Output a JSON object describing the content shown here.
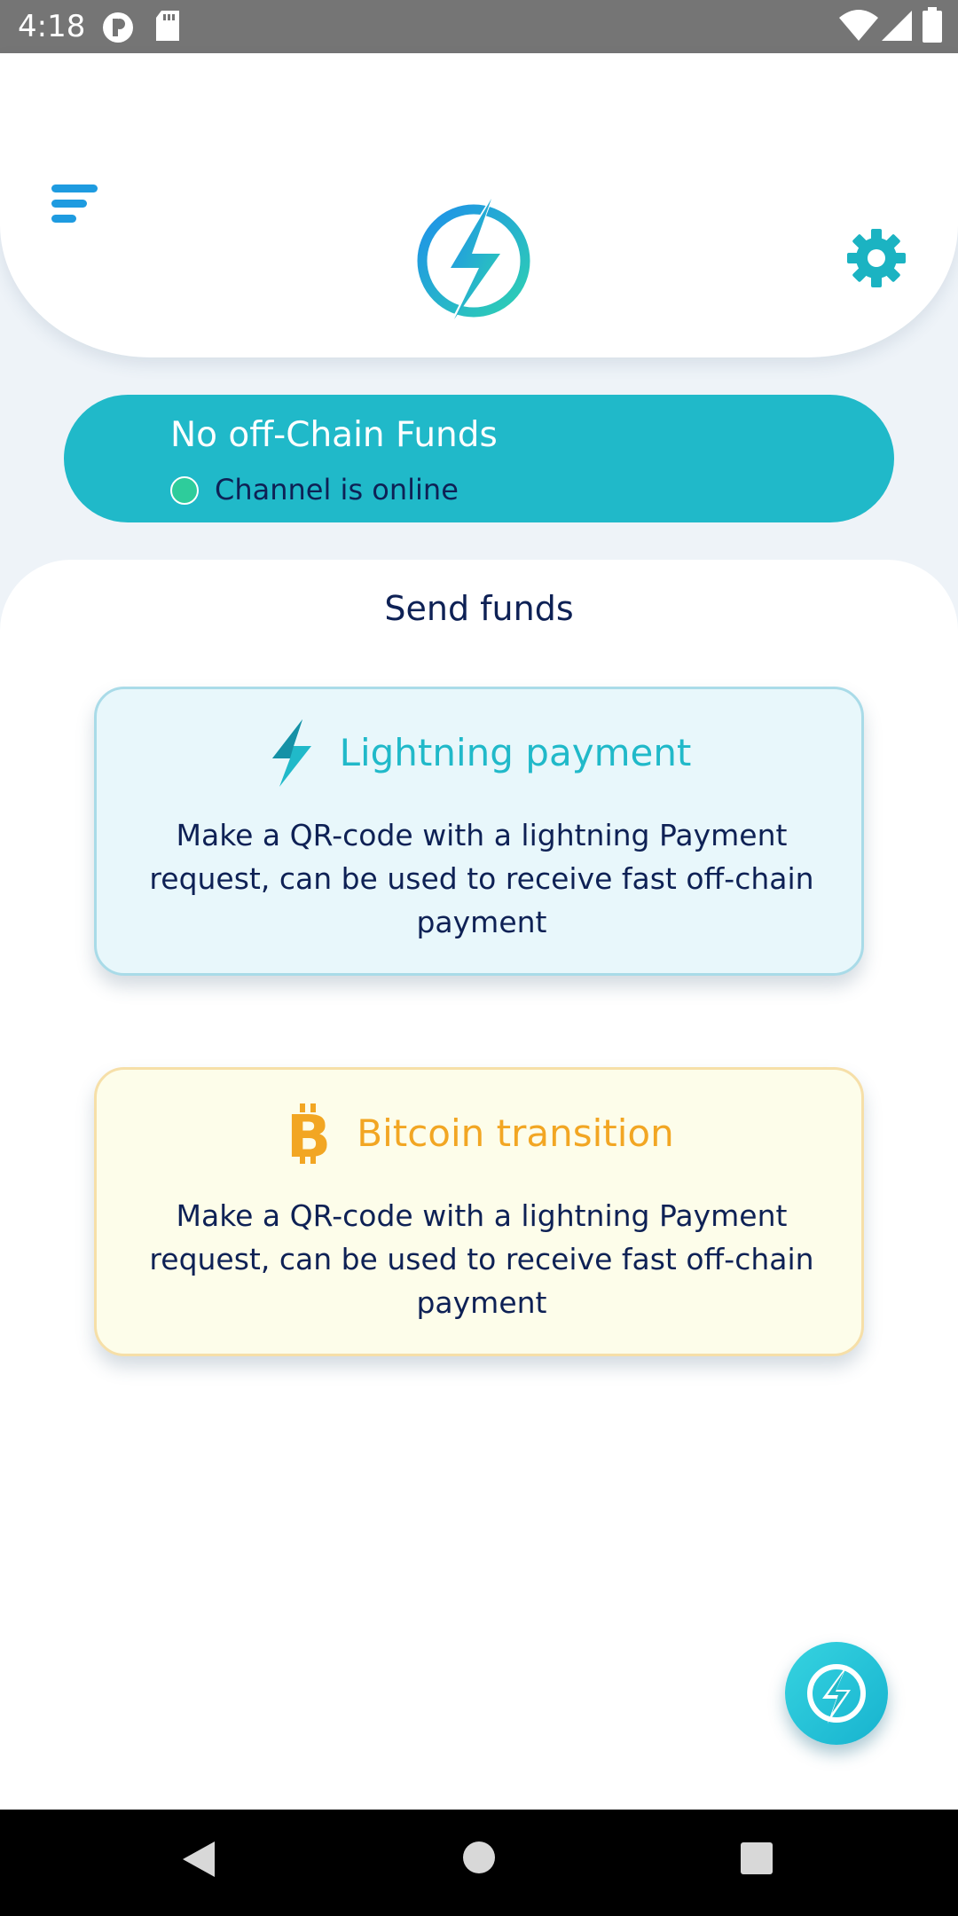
{
  "status_bar": {
    "time": "4:18",
    "icons": [
      "notification-p-icon",
      "sd-card-icon",
      "wifi-icon",
      "cell-signal-icon",
      "battery-icon"
    ]
  },
  "header": {
    "menu_icon": "menu-icon",
    "logo_icon": "lightning-logo-icon",
    "settings_icon": "gear-icon"
  },
  "balance": {
    "title": "No off-Chain Funds",
    "status": "Channel is online"
  },
  "send": {
    "title": "Send funds",
    "cards": [
      {
        "icon": "lightning-icon",
        "title": "Lightning payment",
        "description": "Make a QR-code with a lightning Payment request, can be used to receive fast off-chain payment"
      },
      {
        "icon": "bitcoin-icon",
        "title": "Bitcoin transition",
        "description": "Make a QR-code with a lightning Payment request, can be used to receive fast off-chain payment"
      }
    ]
  },
  "fab": {
    "icon": "lightning-circle-icon"
  },
  "nav": {
    "icons": [
      "back-icon",
      "home-icon",
      "recents-icon"
    ]
  },
  "colors": {
    "accent": "#20b9c9",
    "text": "#0e2155",
    "bitcoin": "#f2a623",
    "status_dot": "#2ecc9b"
  }
}
